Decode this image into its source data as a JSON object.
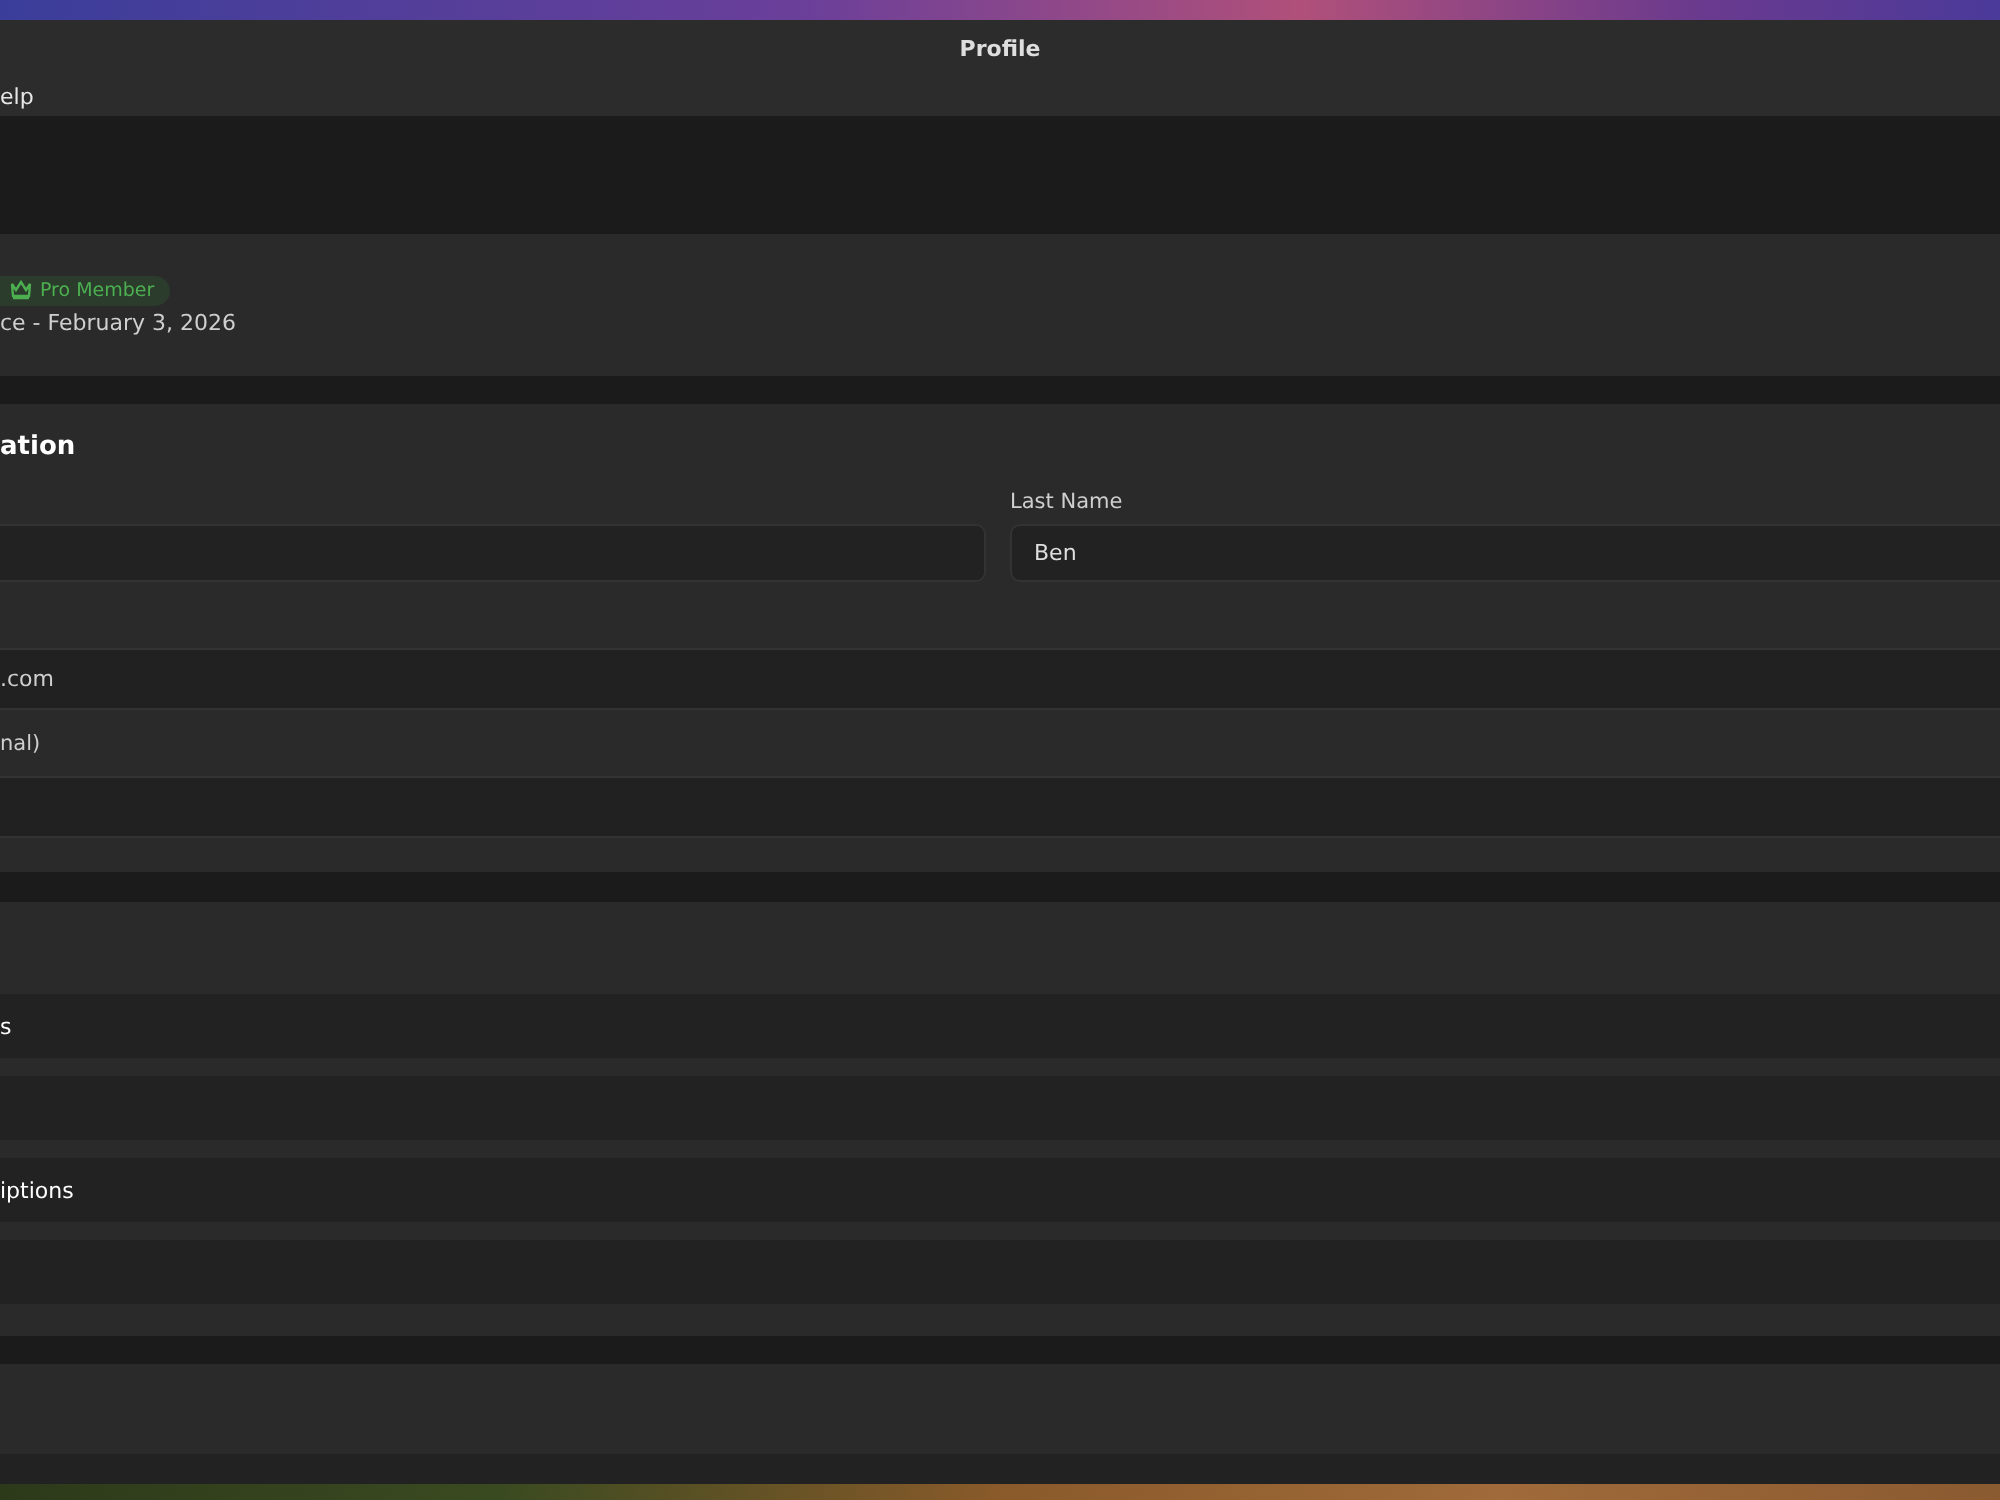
{
  "window": {
    "title": "Profile"
  },
  "menu": [
    {
      "label": "elp"
    }
  ],
  "profile_card": {
    "badge": "Pro Member",
    "member_since": "ce - February 3, 2026"
  },
  "personal_section": {
    "heading": "ation",
    "last_name": {
      "label": "Last Name",
      "value": "Ben"
    },
    "email": {
      "value": ".com"
    },
    "optional_label": "nal)"
  },
  "settings_rows": [
    {
      "label": "s"
    },
    {
      "label": "iptions"
    }
  ]
}
